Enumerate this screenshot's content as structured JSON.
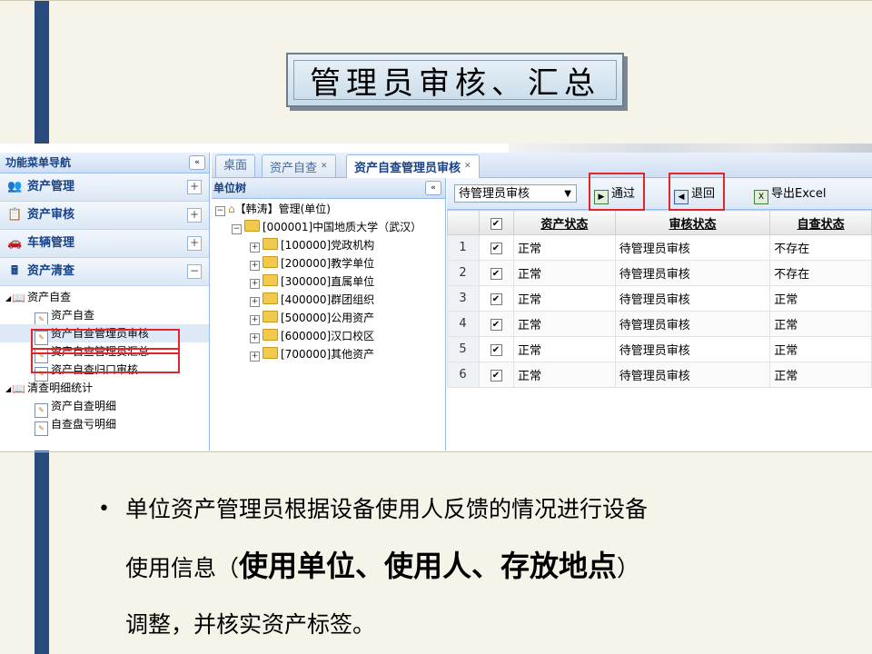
{
  "slide": {
    "title": "管理员审核、汇总",
    "bullet_line1": "单位资产管理员根据设备使用人反馈的情况进行设备",
    "bullet_line2_pre": "使用信息（",
    "bullet_line2_bold": "使用单位、使用人、存放地点",
    "bullet_line2_post": "）",
    "bullet_line3": "调整，并核实资产标签。"
  },
  "nav": {
    "header": "功能菜单导航",
    "collapse": "«",
    "sections": [
      {
        "label": "资产管理",
        "icon": "users-icon",
        "toggle": "+"
      },
      {
        "label": "资产审核",
        "icon": "clipboard-icon",
        "toggle": "+"
      },
      {
        "label": "车辆管理",
        "icon": "car-icon",
        "toggle": "+"
      },
      {
        "label": "资产清查",
        "icon": "calculator-icon",
        "toggle": "−"
      }
    ],
    "tree": [
      {
        "label": "资产自查",
        "expander": "◢"
      },
      {
        "label": "资产自查"
      },
      {
        "label": "资产自查管理员审核"
      },
      {
        "label": "资产自查管理员汇总"
      },
      {
        "label": "资产自查归口审核"
      },
      {
        "label": "清查明细统计",
        "expander": "◢"
      },
      {
        "label": "资产自查明细"
      },
      {
        "label": "自查盘亏明细"
      }
    ]
  },
  "tabs": [
    {
      "label": "桌面"
    },
    {
      "label": "资产自查",
      "close": "✕"
    },
    {
      "label": "资产自查管理员审核",
      "close": "✕"
    }
  ],
  "unit_tree": {
    "header": "单位树",
    "collapse": "«",
    "root": "【韩涛】管理(单位)",
    "child": "[000001]中国地质大学（武汉）",
    "nodes": [
      "[100000]党政机构",
      "[200000]教学单位",
      "[300000]直属单位",
      "[400000]群团组织",
      "[500000]公用资产",
      "[600000]汉口校区",
      "[700000]其他资产"
    ]
  },
  "toolbar": {
    "filter_value": "待管理员审核",
    "pass_label": "通过",
    "return_label": "退回",
    "export_label": "导出Excel"
  },
  "grid": {
    "headers": [
      "资产状态",
      "审核状态",
      "自查状态"
    ],
    "rows": [
      {
        "n": "1",
        "asset": "正常",
        "audit": "待管理员审核",
        "self": "不存在"
      },
      {
        "n": "2",
        "asset": "正常",
        "audit": "待管理员审核",
        "self": "不存在"
      },
      {
        "n": "3",
        "asset": "正常",
        "audit": "待管理员审核",
        "self": "正常"
      },
      {
        "n": "4",
        "asset": "正常",
        "audit": "待管理员审核",
        "self": "正常"
      },
      {
        "n": "5",
        "asset": "正常",
        "audit": "待管理员审核",
        "self": "正常"
      },
      {
        "n": "6",
        "asset": "正常",
        "audit": "待管理员审核",
        "self": "正常"
      }
    ]
  },
  "colors": {
    "highlight": "#e0262b",
    "sidebar": "#2b4a7c",
    "nav_text": "#15428b"
  }
}
